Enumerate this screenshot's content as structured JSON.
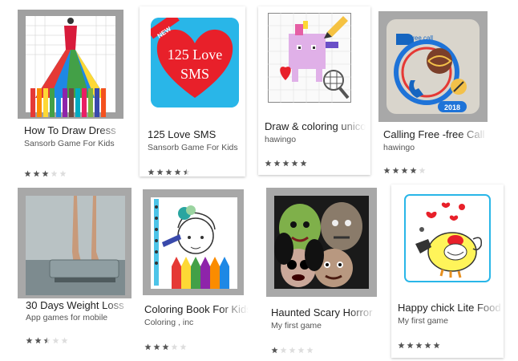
{
  "apps": [
    {
      "title": "How To Draw Dress",
      "developer": "Sansorb Game For Kids",
      "rating": 3,
      "icon": "dress-drawing-icon"
    },
    {
      "title": "125 Love SMS",
      "developer": "Sansorb Game For Kids",
      "rating": 4.5,
      "icon": "love-sms-icon",
      "badge": "NEW",
      "icon_text_1": "125 Love",
      "icon_text_2": "SMS"
    },
    {
      "title": "Draw & coloring unicorn",
      "developer": "hawingo",
      "rating": 5,
      "icon": "unicorn-coloring-icon"
    },
    {
      "title": "Calling Free -free Call",
      "developer": "hawingo",
      "rating": 4,
      "icon": "free-call-icon",
      "badge_top": "free call",
      "badge_year": "2018"
    },
    {
      "title": "30 Days Weight Loss",
      "developer": "App games for mobile",
      "rating": 2.5,
      "icon": "weight-scale-icon"
    },
    {
      "title": "Coloring Book For Kids",
      "developer": "Coloring , inc",
      "rating": 3,
      "icon": "coloring-book-icon"
    },
    {
      "title": "Haunted Scary Horror",
      "developer": "My first game",
      "rating": 1,
      "icon": "scary-faces-icon"
    },
    {
      "title": "Happy chick Lite Food",
      "developer": "My first game",
      "rating": 5,
      "icon": "happy-chick-icon"
    }
  ],
  "colors": {
    "star_filled": "#555555",
    "star_empty": "#dddddd",
    "love_bg": "#29b6e8",
    "heart_red": "#e8202a"
  }
}
